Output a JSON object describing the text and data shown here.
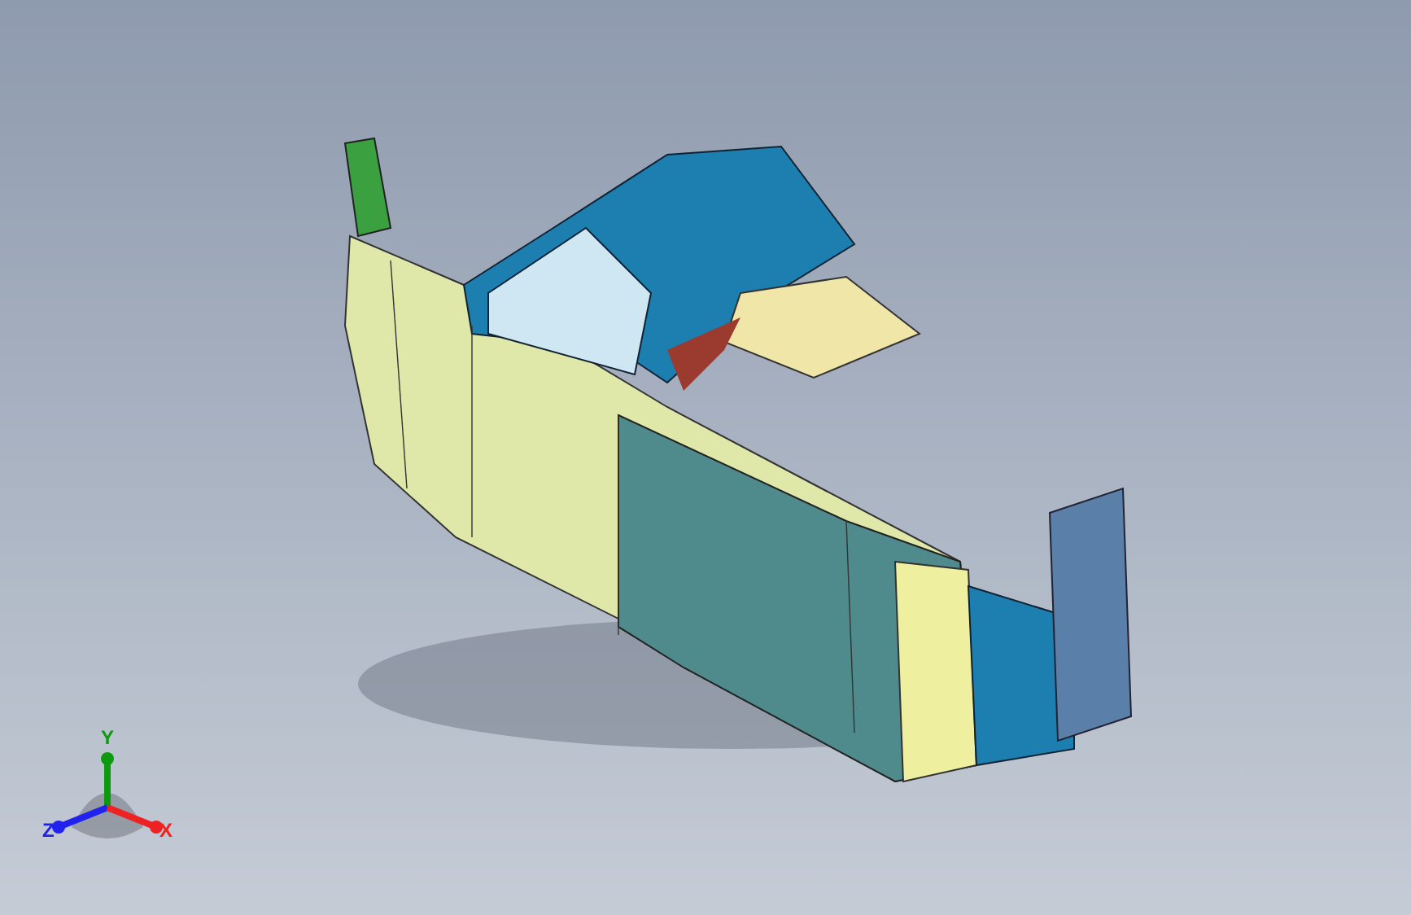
{
  "viewport": {
    "triad": [
      {
        "label": "Y",
        "color": "#0e9a0e"
      },
      {
        "label": "Z",
        "color": "#2222ee"
      },
      {
        "label": "X",
        "color": "#ee2222"
      }
    ]
  }
}
